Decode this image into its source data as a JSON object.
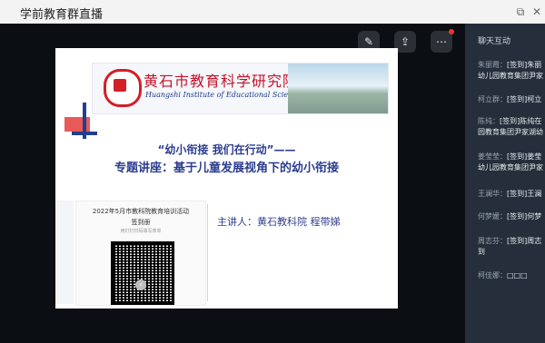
{
  "window": {
    "title": "学前教育群直播",
    "icons": [
      "popout-icon",
      "close-icon"
    ]
  },
  "stage": {
    "top_icons": [
      "annotate-icon",
      "share-screen-icon",
      "more-icon"
    ]
  },
  "slide": {
    "institute_cn": "黄石市教育科学研究院",
    "institute_en": "Huangshi Institute of Educational Science",
    "heading1": "“幼小衔接 我们在行动”——",
    "heading2": "专题讲座：基于儿童发展视角下的幼小衔接",
    "qr_title": "2022年5月市教科院教育培训活动",
    "qr_subtitle": "签到册",
    "qr_hint": "用钉钉扫码填写表单",
    "speaker": "主讲人：黄石教科院 程带娣"
  },
  "chat": {
    "header": "聊天互动",
    "messages": [
      {
        "name": "朱丽霞：",
        "text": "[签到]朱丽",
        "line2": "幼儿园教育集团尹家"
      },
      {
        "name": "柯立群：",
        "text": "[签到]柯立",
        "line2": ""
      },
      {
        "name": "陈纯：",
        "text": "[签到]陈纯在",
        "line2": "园教育集团尹家湖幼"
      },
      {
        "name": "姜莹莹：",
        "text": "[签到]姜莹",
        "line2": "幼儿园教育集团尹家"
      },
      {
        "name": "王澜华：",
        "text": "[签到]王澜",
        "line2": ""
      },
      {
        "name": "何梦媛：",
        "text": "[签到]何梦",
        "line2": ""
      },
      {
        "name": "周志芬：",
        "text": "[签到]周志",
        "line2": "到"
      },
      {
        "name": "柯佳娜：",
        "text": "□□□",
        "line2": ""
      }
    ]
  }
}
